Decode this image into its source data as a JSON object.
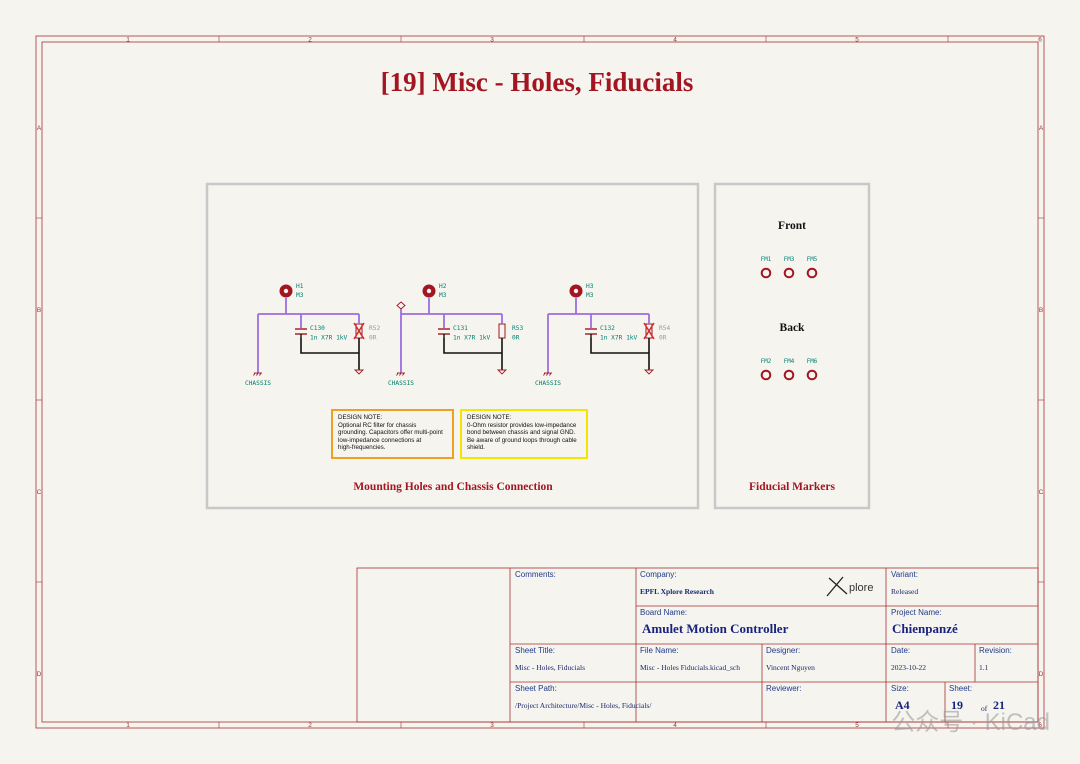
{
  "sheet": {
    "title": "[19] Misc - Holes, Fiducials",
    "columns": [
      "1",
      "2",
      "3",
      "4",
      "5",
      "6"
    ],
    "rows": [
      "A",
      "B",
      "C",
      "D"
    ]
  },
  "panels": {
    "left_caption": "Mounting Holes and Chassis Connection",
    "right_caption": "Fiducial Markers",
    "front_label": "Front",
    "back_label": "Back"
  },
  "holes": [
    {
      "ref": "H1",
      "value": "M3",
      "cap_ref": "C130",
      "cap_value": "1n X7R 1kV",
      "res_ref": "R52",
      "res_value": "0R",
      "res_dnp": true,
      "net": "CHASSIS"
    },
    {
      "ref": "H2",
      "value": "M3",
      "cap_ref": "C131",
      "cap_value": "1n X7R 1kV",
      "res_ref": "R53",
      "res_value": "0R",
      "res_dnp": false,
      "net": "CHASSIS"
    },
    {
      "ref": "H3",
      "value": "M3",
      "cap_ref": "C132",
      "cap_value": "1n X7R 1kV",
      "res_ref": "R54",
      "res_value": "0R",
      "res_dnp": true,
      "net": "CHASSIS"
    }
  ],
  "fiducials": {
    "front": [
      "FM1",
      "FM3",
      "FM5"
    ],
    "back": [
      "FM2",
      "FM4",
      "FM6"
    ]
  },
  "notes": [
    {
      "lines": [
        "DESIGN NOTE:",
        "Optional RC filter for chassis",
        "grounding. Capacitors offer multi-point",
        "low-impedance connections at",
        "high-frequencies."
      ],
      "border": "#f0a020"
    },
    {
      "lines": [
        "DESIGN NOTE:",
        "0-Ohm resistor provides low-impedance",
        "bond between chassis and signal GND.",
        "Be aware of ground loops through cable",
        "shield."
      ],
      "border": "#f2e600"
    }
  ],
  "title_block": {
    "comments_label": "Comments:",
    "company_label": "Company:",
    "company": "EPFL Xplore Research",
    "logo_text": "plore",
    "variant_label": "Variant:",
    "variant": "Released",
    "board_label": "Board Name:",
    "board": "Amulet Motion Controller",
    "project_label": "Project Name:",
    "project": "Chienpanzé",
    "sheet_title_label": "Sheet Title:",
    "sheet_title": "Misc - Holes, Fiducials",
    "file_label": "File Name:",
    "file": "Misc - Holes Fiducials.kicad_sch",
    "designer_label": "Designer:",
    "designer": "Vincent Nguyen",
    "date_label": "Date:",
    "date": "2023-10-22",
    "revision_label": "Revision:",
    "revision": "1.1",
    "path_label": "Sheet Path:",
    "path": "/Project Architecture/Misc - Holes, Fiducials/",
    "reviewer_label": "Reviewer:",
    "size_label": "Size:",
    "size": "A4",
    "sheet_label": "Sheet:",
    "sheet_no": "19",
    "of": "of",
    "sheet_total": "21"
  },
  "watermark": "公众号 · KiCad",
  "colors": {
    "frame": "#a83232",
    "title": "#a31621",
    "wire": "#9b6ee0",
    "component": "#a31621",
    "ref_text": "#00806e",
    "panel": "#c8c8c8",
    "ground": "#8b0000"
  }
}
